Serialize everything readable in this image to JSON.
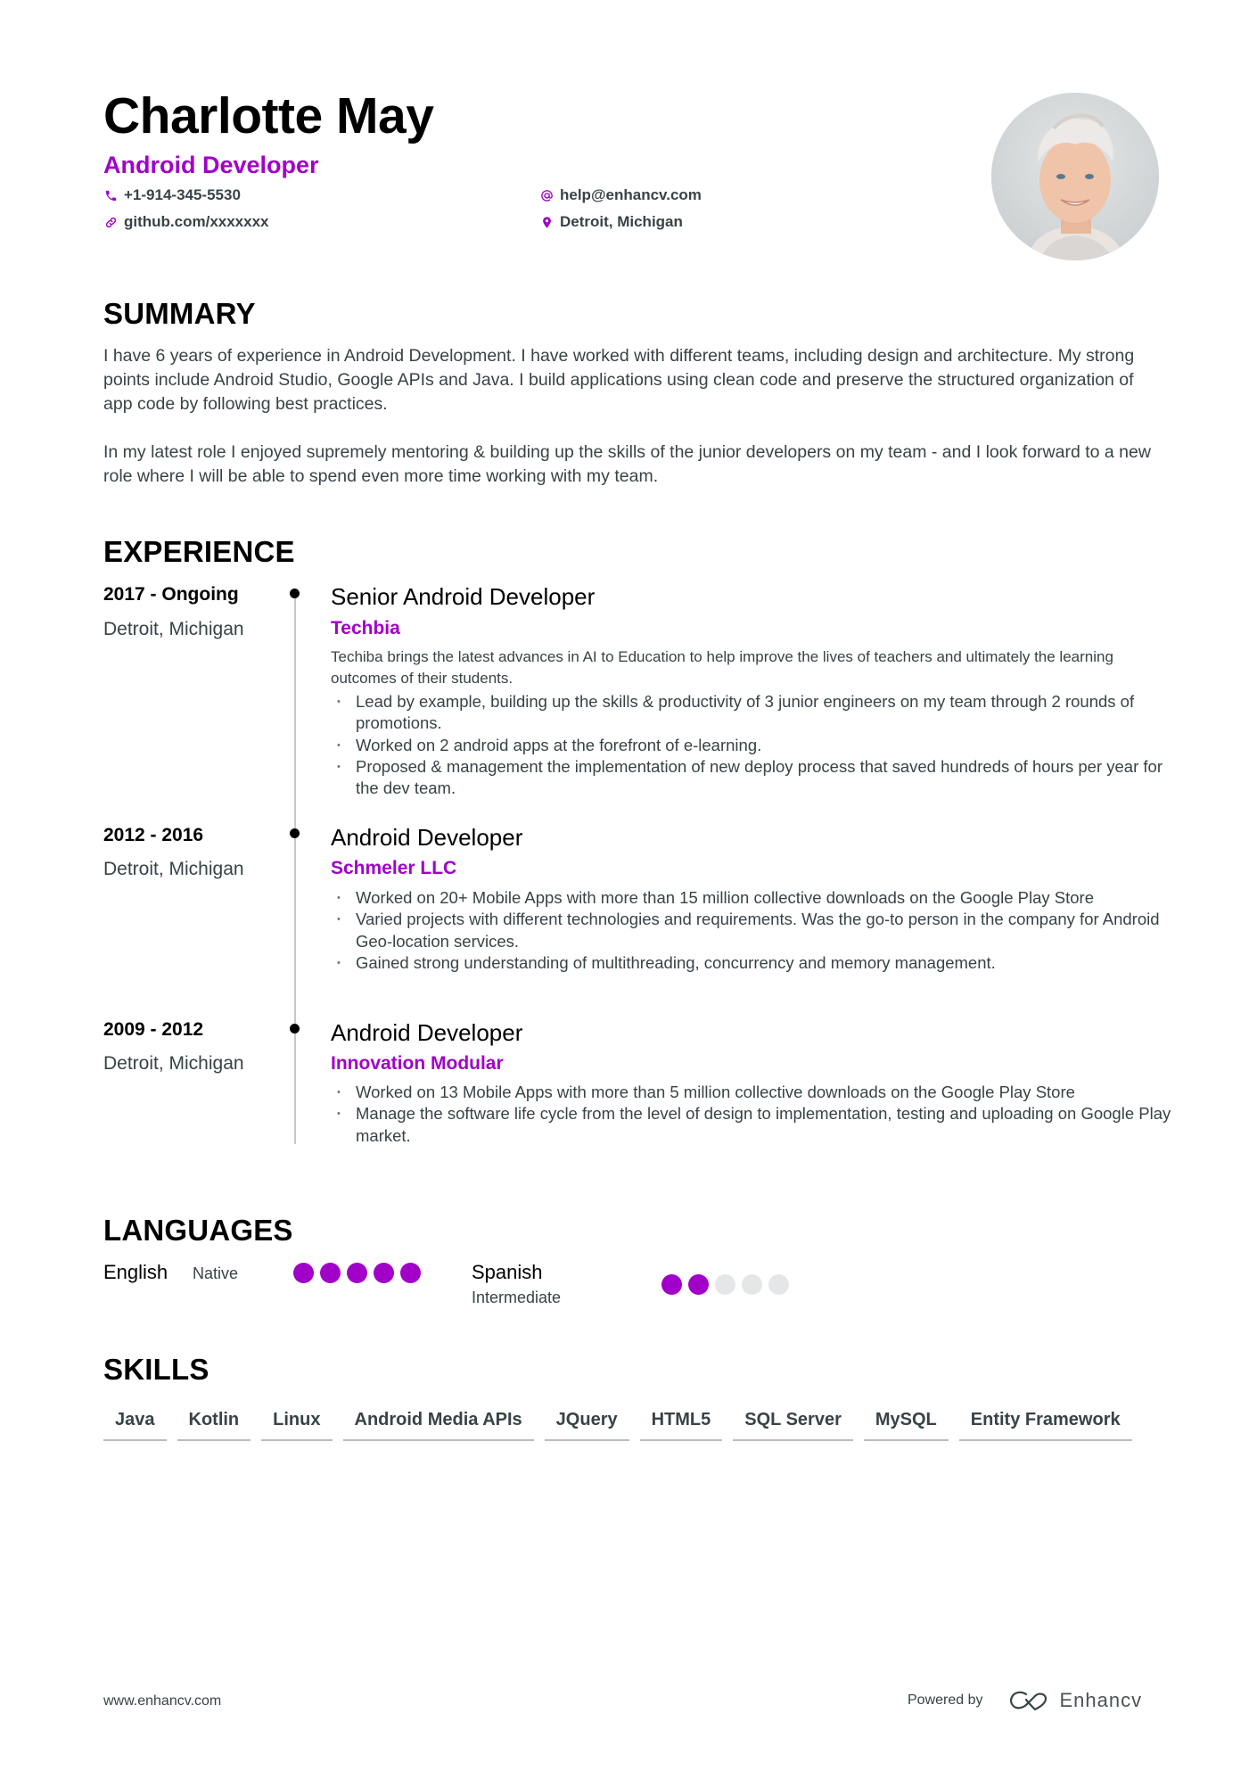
{
  "header": {
    "name": "Charlotte May",
    "title": "Android Developer",
    "contacts": [
      {
        "icon": "phone-icon",
        "text": "+1-914-345-5530"
      },
      {
        "icon": "at-sign-icon",
        "text": "help@enhancv.com"
      },
      {
        "icon": "link-icon",
        "text": "github.com/xxxxxxx"
      },
      {
        "icon": "location-pin-icon",
        "text": "Detroit, Michigan"
      }
    ],
    "photo_alt": "Profile photo of Charlotte May"
  },
  "summary": {
    "heading": "SUMMARY",
    "paragraphs": [
      "I have 6 years of experience in Android Development. I have worked with different teams, including design and architecture. My strong points include Android Studio, Google APIs and Java. I build applications using clean code and preserve the structured organization of app code by following best practices.",
      "In my latest role I enjoyed supremely mentoring & building up the skills of the junior developers on my team - and I look forward to a new role where I will be able to spend even more time working with my team."
    ]
  },
  "experience": {
    "heading": "EXPERIENCE",
    "entries": [
      {
        "dates": "2017 - Ongoing",
        "location": "Detroit, Michigan",
        "title": "Senior Android Developer",
        "company": "Techbia",
        "description": "Techiba brings the latest advances in AI to Education to help improve the lives of teachers and ultimately the learning outcomes of their students.",
        "bullets": [
          "Lead by example, building up the skills & productivity of 3 junior engineers on my team through 2 rounds of promotions.",
          "Worked on 2 android apps at the forefront of e-learning.",
          "Proposed & management the implementation of new deploy process that saved hundreds of hours per year for the dev team."
        ]
      },
      {
        "dates": "2012 - 2016",
        "location": "Detroit, Michigan",
        "title": "Android Developer",
        "company": "Schmeler LLC",
        "bullets": [
          "Worked on 20+ Mobile Apps with more than 15 million collective downloads on the Google Play Store",
          "Varied projects with different technologies and requirements. Was the go-to person in the company for Android Geo-location services.",
          "Gained strong understanding of multithreading, concurrency and memory management."
        ]
      },
      {
        "dates": "2009 - 2012",
        "location": "Detroit, Michigan",
        "title": "Android Developer",
        "company": "Innovation Modular",
        "bullets": [
          "Worked on 13 Mobile Apps with more than 5 million collective downloads on the Google Play Store",
          "Manage the software life cycle from the level of design to implementation, testing and uploading on Google Play market."
        ]
      }
    ]
  },
  "languages": {
    "heading": "LANGUAGES",
    "items": [
      {
        "name": "English",
        "level": "Native",
        "rating": 5,
        "max": 5
      },
      {
        "name": "Spanish",
        "level": "Intermediate",
        "rating": 2,
        "max": 5
      }
    ]
  },
  "skills": {
    "heading": "SKILLS",
    "items": [
      "Java",
      "Kotlin",
      "Linux",
      "Android Media APIs",
      "JQuery",
      "HTML5",
      "SQL Server",
      "MySQL",
      "Entity Framework"
    ]
  },
  "footer": {
    "website": "www.enhancv.com",
    "powered_by": "Powered by",
    "brand": "Enhancv"
  },
  "colors": {
    "accent": "#a100c9",
    "text": "#384347",
    "heading": "#000000",
    "dot_inactive": "#e4e6e7"
  }
}
